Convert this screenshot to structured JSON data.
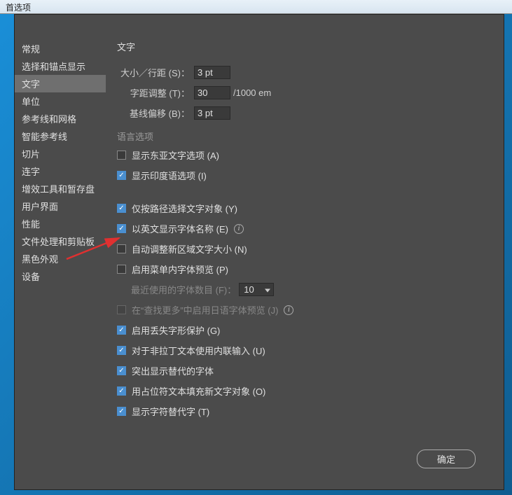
{
  "titlebar": "首选项",
  "sidebar": {
    "items": [
      "常规",
      "选择和锚点显示",
      "文字",
      "单位",
      "参考线和网格",
      "智能参考线",
      "切片",
      "连字",
      "增效工具和暂存盘",
      "用户界面",
      "性能",
      "文件处理和剪贴板",
      "黑色外观",
      "设备"
    ],
    "activeIndex": 2
  },
  "header": "文字",
  "fields": {
    "size_label": "大小／行距 (S)：",
    "size_value": "3 pt",
    "tracking_label": "字距调整 (T)：",
    "tracking_value": "30",
    "tracking_suffix": "/1000 em",
    "baseline_label": "基线偏移 (B)：",
    "baseline_value": "3 pt"
  },
  "lang_section": "语言选项",
  "checks": {
    "east_asian": "显示东亚文字选项 (A)",
    "indic": "显示印度语选项 (I)",
    "path_select": "仅按路径选择文字对象 (Y)",
    "english_font": "以英文显示字体名称 (E)",
    "auto_resize": "自动调整新区域文字大小 (N)",
    "menu_preview": "启用菜单内字体预览 (P)",
    "recent_label": "最近使用的字体数目 (F)：",
    "recent_value": "10",
    "jp_preview": "在“查找更多”中启用日语字体预览 (J)",
    "missing_glyph": "启用丢失字形保护 (G)",
    "inline_input": "对于非拉丁文本使用内联输入 (U)",
    "alt_font": "突出显示替代的字体",
    "placeholder_text": "用占位符文本填充新文字对象 (O)",
    "alt_glyph": "显示字符替代字 (T)"
  },
  "ok_button": "确定"
}
